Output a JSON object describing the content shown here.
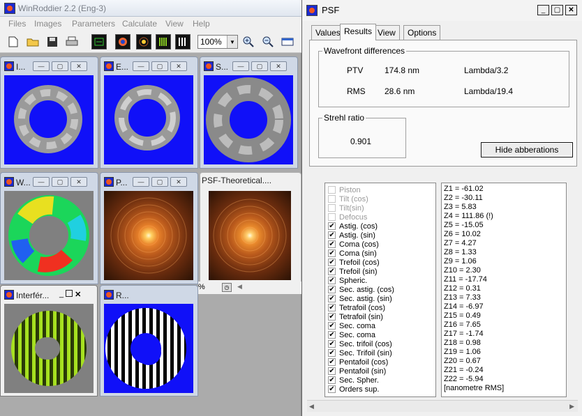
{
  "main_window": {
    "title": "WinRoddier 2.2 (Eng-3)",
    "menu": [
      "Files",
      "Images",
      "Parameters",
      "Calculate",
      "View",
      "Help"
    ],
    "zoom": "100%"
  },
  "children": [
    {
      "title": "I..."
    },
    {
      "title": "E..."
    },
    {
      "title": "S..."
    },
    {
      "title": "W..."
    },
    {
      "title": "P..."
    },
    {
      "title": "PSF-Theoretical...."
    },
    {
      "title": "Interfér..."
    },
    {
      "title": "R..."
    }
  ],
  "icons": {
    "new": "new-file-icon",
    "open": "open-folder-icon",
    "save": "save-icon",
    "print": "print-icon",
    "zoom_in": "zoom-in-icon",
    "zoom_out": "zoom-out-icon"
  },
  "psf_window": {
    "title": "PSF",
    "tabs": [
      "Values",
      "Results",
      "View",
      "Options"
    ],
    "active_tab": "Results",
    "wavefront": {
      "legend": "Wavefront differences",
      "ptv_label": "PTV",
      "ptv_value": "174.8 nm",
      "ptv_lambda": "Lambda/3.2",
      "rms_label": "RMS",
      "rms_value": "28.6 nm",
      "rms_lambda": "Lambda/19.4"
    },
    "strehl": {
      "legend": "Strehl ratio",
      "value": "0.901"
    },
    "hide_button": "Hide abberations",
    "terms": [
      {
        "label": "Piston",
        "checked": false
      },
      {
        "label": "Tilt (cos)",
        "checked": false
      },
      {
        "label": "Tilt(sin)",
        "checked": false
      },
      {
        "label": "Defocus",
        "checked": false
      },
      {
        "label": "Astig. (cos)",
        "checked": true
      },
      {
        "label": "Astig. (sin)",
        "checked": true
      },
      {
        "label": "Coma (cos)",
        "checked": true
      },
      {
        "label": "Coma (sin)",
        "checked": true
      },
      {
        "label": "Trefoil (cos)",
        "checked": true
      },
      {
        "label": "Trefoil (sin)",
        "checked": true
      },
      {
        "label": "Spheric.",
        "checked": true
      },
      {
        "label": "Sec. astig. (cos)",
        "checked": true
      },
      {
        "label": "Sec. astig. (sin)",
        "checked": true
      },
      {
        "label": "Tetrafoil (cos)",
        "checked": true
      },
      {
        "label": "Tetrafoil (sin)",
        "checked": true
      },
      {
        "label": "Sec. coma",
        "checked": true
      },
      {
        "label": "Sec. coma",
        "checked": true
      },
      {
        "label": "Sec. trifoil (cos)",
        "checked": true
      },
      {
        "label": "Sec. Trifoil (sin)",
        "checked": true
      },
      {
        "label": "Pentafoil (cos)",
        "checked": true
      },
      {
        "label": "Pentafoil (sin)",
        "checked": true
      },
      {
        "label": "Sec. Spher.",
        "checked": true
      },
      {
        "label": "Orders sup.",
        "checked": true
      }
    ],
    "zernike": [
      "Z1 = -61.02",
      "Z2 = -30.11",
      "Z3 = 5.83",
      "Z4 = 111.86  (!)",
      "Z5 = -15.05",
      "Z6 = 10.02",
      "Z7 = 4.27",
      "Z8 = 1.33",
      "Z9 = 1.06",
      "Z10 = 2.30",
      "Z11 = -17.74",
      "Z12 = 0.31",
      "Z13 = 7.33",
      "Z14 = -6.97",
      "Z15 = 0.49",
      "Z16 = 7.65",
      "Z17 = -1.74",
      "Z18 = 0.98",
      "Z19 = 1.06",
      "Z20 = 0.67",
      "Z21 = -0.24",
      "Z22 = -5.94",
      "[nanometre RMS]"
    ]
  },
  "status_fragment": "%"
}
